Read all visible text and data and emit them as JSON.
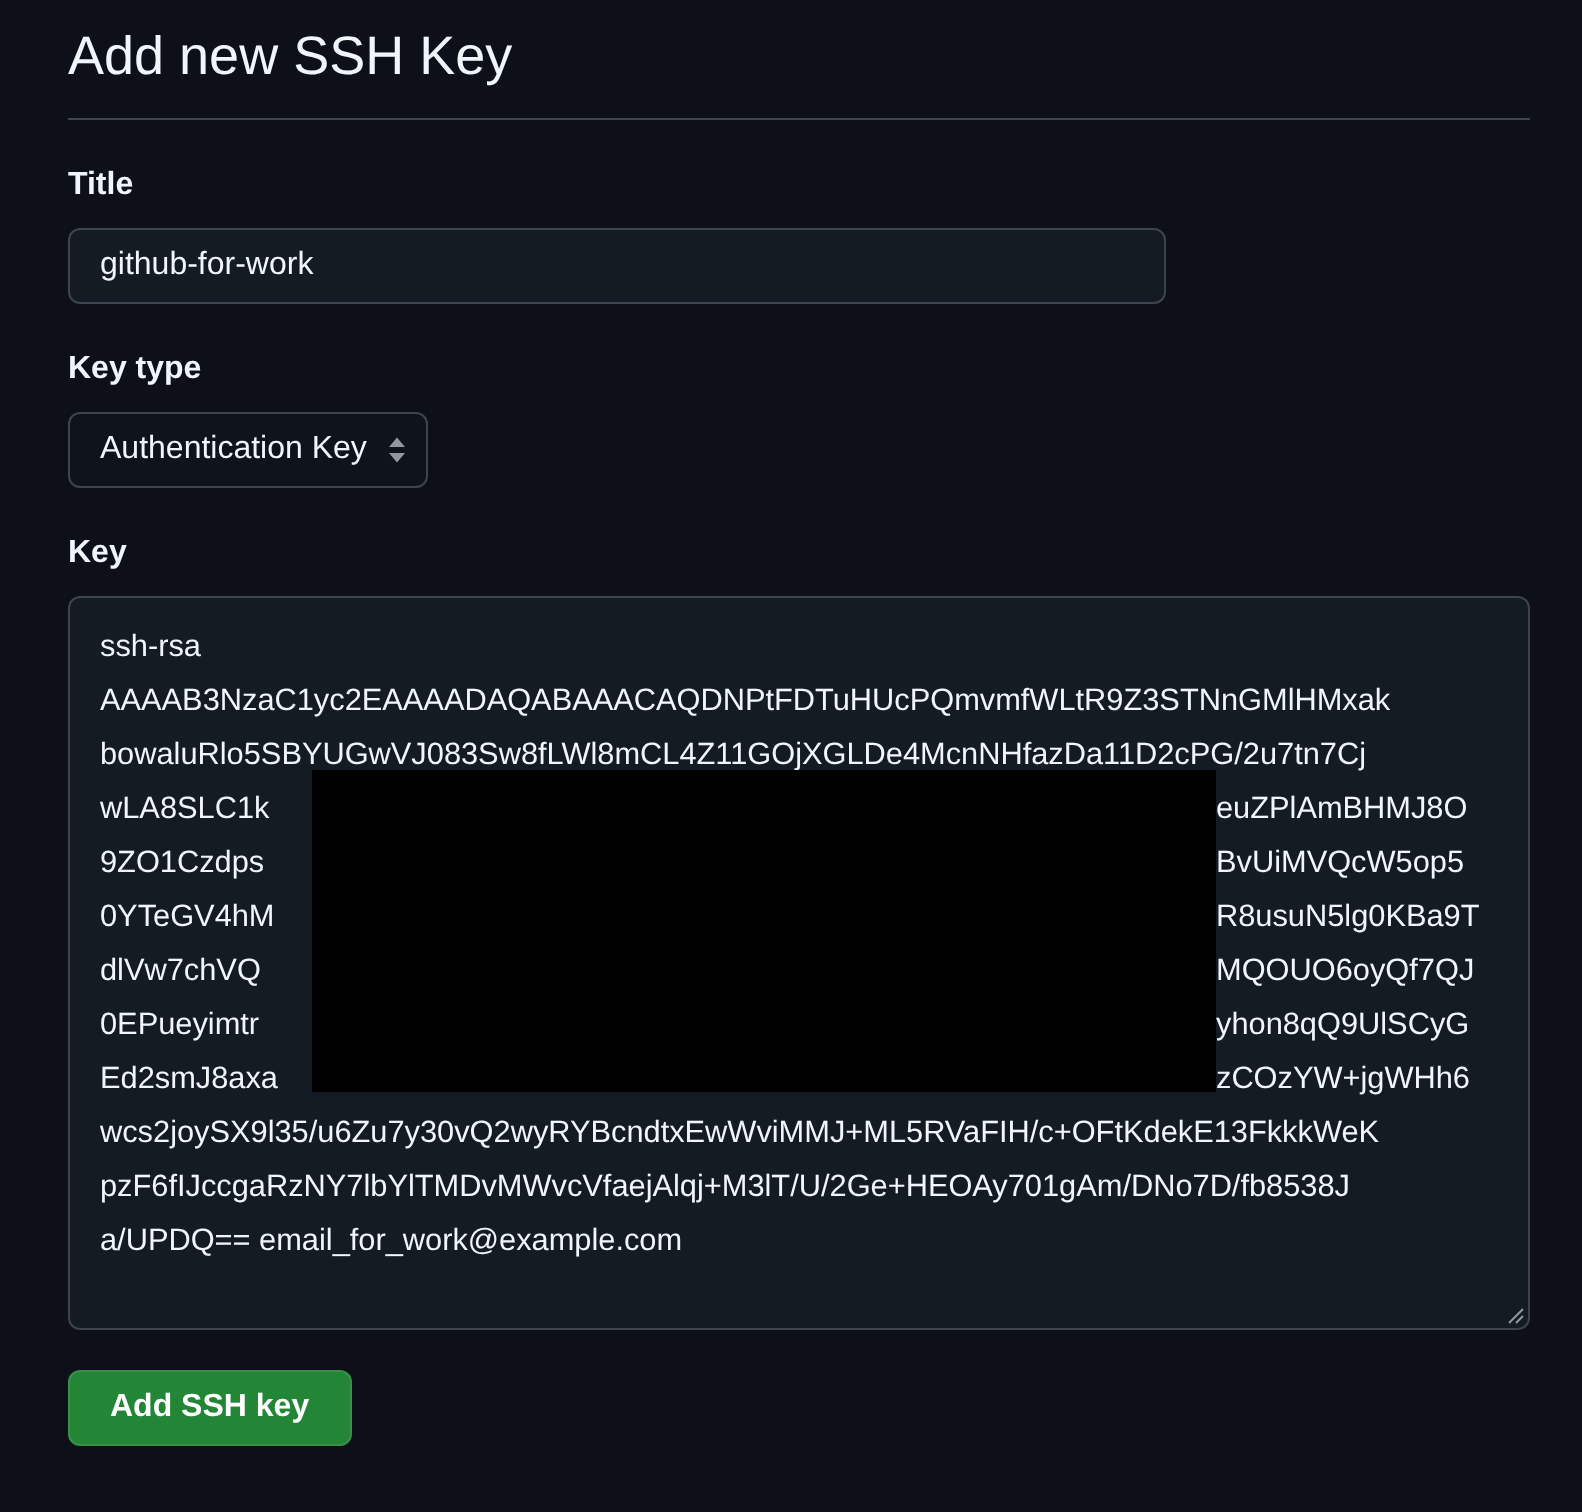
{
  "heading": "Add new SSH Key",
  "fields": [
    {
      "kind": "text",
      "label": "Title",
      "value": "github-for-work"
    },
    {
      "kind": "select",
      "label": "Key type",
      "value": "Authentication Key"
    },
    {
      "kind": "textarea",
      "label": "Key",
      "lines": [
        {
          "kind": "full",
          "text": "ssh-rsa"
        },
        {
          "kind": "full",
          "text": "AAAAB3NzaC1yc2EAAAADAQABAAACAQDNPtFDTuHUcPQmvmfWLtR9Z3STNnGMlHMxak"
        },
        {
          "kind": "full",
          "text": "bowaluRlo5SBYUGwVJ083Sw8fLWl8mCL4Z11GOjXGLDe4McnNHfazDa11D2cPG/2u7tn7Cj"
        },
        {
          "kind": "covered",
          "start": "wLA8SLC1k",
          "end": "euZPlAmBHMJ8O"
        },
        {
          "kind": "covered",
          "start": "9ZO1Czdps",
          "end": "BvUiMVQcW5op5"
        },
        {
          "kind": "covered",
          "start": "0YTeGV4hM",
          "end": "R8usuN5lg0KBa9T"
        },
        {
          "kind": "covered",
          "start": "dlVw7chVQ",
          "end": "MQOUO6oyQf7QJ"
        },
        {
          "kind": "covered",
          "start": "0EPueyimtr",
          "end": "yhon8qQ9UlSCyG"
        },
        {
          "kind": "covered",
          "start": "Ed2smJ8axa",
          "end": "zCOzYW+jgWHh6"
        },
        {
          "kind": "full",
          "text": "wcs2joySX9l35/u6Zu7y30vQ2wyRYBcndtxEwWviMMJ+ML5RVaFIH/c+OFtKdekE13FkkkWeK"
        },
        {
          "kind": "full",
          "text": "pzF6fIJccgaRzNY7lbYlTMDvMWvcVfaejAlqj+M3lT/U/2Ge+HEOAy701gAm/DNo7D/fb8538J"
        },
        {
          "kind": "full",
          "text": "a/UPDQ== email_for_work@example.com"
        }
      ]
    }
  ],
  "buttons": [
    {
      "kind": "primary",
      "label": "Add SSH key"
    }
  ]
}
